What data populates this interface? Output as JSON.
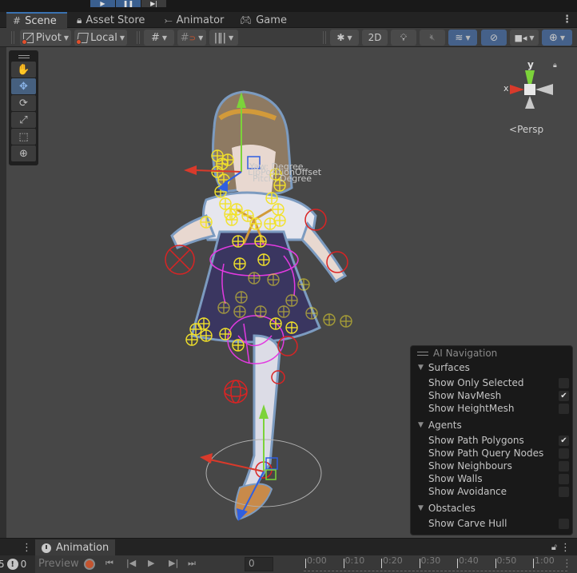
{
  "playbar": {
    "play_icon": "play-icon",
    "pause_icon": "pause-icon",
    "step_icon": "step-icon"
  },
  "tabs": [
    {
      "label": "Scene",
      "icon": "grid-icon",
      "active": true
    },
    {
      "label": "Asset Store",
      "icon": "shopping-bag-icon",
      "active": false
    },
    {
      "label": "Animator",
      "icon": "animator-icon",
      "active": false
    },
    {
      "label": "Game",
      "icon": "gamepad-icon",
      "active": false
    }
  ],
  "toolbar": {
    "pivot_label": "Pivot",
    "local_label": "Local",
    "toggle_2d_label": "2D"
  },
  "tools": [
    {
      "name": "hand-tool",
      "glyph": "✋",
      "active": false
    },
    {
      "name": "move-tool",
      "glyph": "✥",
      "active": true
    },
    {
      "name": "rotate-tool",
      "glyph": "⟳",
      "active": false
    },
    {
      "name": "scale-tool",
      "glyph": "⤢",
      "active": false
    },
    {
      "name": "rect-tool",
      "glyph": "⬚",
      "active": false
    },
    {
      "name": "transform-tool",
      "glyph": "⊕",
      "active": false
    }
  ],
  "gizmo": {
    "x_label": "x",
    "y_label": "y",
    "projection_label": "Persp"
  },
  "scene_labels": {
    "label1": "Yaw: Degree",
    "label2": "LipPositionOffset",
    "label3": "Pitch: Degree"
  },
  "ai_navigation": {
    "title": "AI Navigation",
    "sections": [
      {
        "title": "Surfaces",
        "options": [
          {
            "label": "Show Only Selected",
            "checked": false
          },
          {
            "label": "Show NavMesh",
            "checked": true
          },
          {
            "label": "Show HeightMesh",
            "checked": false
          }
        ]
      },
      {
        "title": "Agents",
        "options": [
          {
            "label": "Show Path Polygons",
            "checked": true
          },
          {
            "label": "Show Path Query Nodes",
            "checked": false
          },
          {
            "label": "Show Neighbours",
            "checked": false
          },
          {
            "label": "Show Walls",
            "checked": false
          },
          {
            "label": "Show Avoidance",
            "checked": false
          }
        ]
      },
      {
        "title": "Obstacles",
        "options": [
          {
            "label": "Show Carve Hull",
            "checked": false
          }
        ]
      }
    ]
  },
  "animation": {
    "tab_label": "Animation",
    "left_count": "5",
    "warning_count": "0",
    "preview_label": "Preview",
    "frame_value": "0",
    "timeline_ticks": [
      "0:00",
      "0:10",
      "0:20",
      "0:30",
      "0:40",
      "0:50",
      "1:00"
    ]
  },
  "colors": {
    "accent_blue": "#3a72b0",
    "active_button": "#45618a",
    "axis_x": "#d93a2b",
    "axis_y": "#7cd33a",
    "axis_z": "#2f5fe0",
    "bone_yellow": "#f2e22a",
    "collider_magenta": "#e23ae0",
    "record_red": "#c4542f"
  }
}
